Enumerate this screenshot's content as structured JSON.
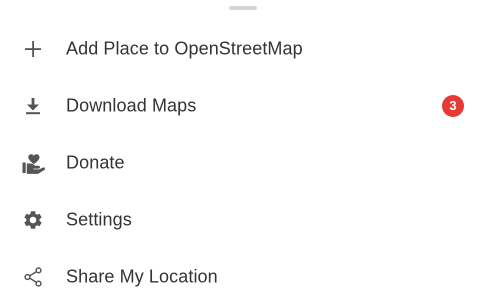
{
  "menu": {
    "items": [
      {
        "label": "Add Place to OpenStreetMap",
        "icon": "plus-icon"
      },
      {
        "label": "Download Maps",
        "icon": "download-icon",
        "badge": "3"
      },
      {
        "label": "Donate",
        "icon": "donate-heart-hand-icon"
      },
      {
        "label": "Settings",
        "icon": "gear-icon"
      },
      {
        "label": "Share My Location",
        "icon": "share-icon"
      }
    ]
  },
  "colors": {
    "icon": "#555555",
    "text": "#333333",
    "badge": "#e53935",
    "handle": "#d6d6d6"
  }
}
